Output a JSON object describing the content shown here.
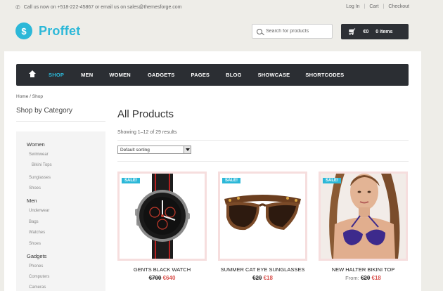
{
  "topbar": {
    "contact": "Call us now on +518-222-45867 or email us on sales@themesforge.com",
    "links": [
      "Log In",
      "Cart",
      "Checkout"
    ]
  },
  "header": {
    "logo_letter": "$",
    "logo_text": "Proffet",
    "search_placeholder": "Search for products",
    "cart_total": "€0",
    "cart_items": "0 items"
  },
  "nav": {
    "items": [
      "SHOP",
      "MEN",
      "WOMEN",
      "GADGETS",
      "PAGES",
      "BLOG",
      "SHOWCASE",
      "SHORTCODES"
    ],
    "active": "SHOP"
  },
  "breadcrumb": "Home / Shop",
  "sidebar": {
    "title": "Shop by Category",
    "categories": [
      {
        "label": "Women",
        "subs": [
          "Swimwear",
          "Bikini Tops",
          "Sunglasses",
          "Shoes"
        ]
      },
      {
        "label": "Men",
        "subs": [
          "Underwear",
          "Bags",
          "Watches",
          "Shoes"
        ]
      },
      {
        "label": "Gadgets",
        "subs": [
          "Phones",
          "Computers",
          "Cameras"
        ]
      }
    ]
  },
  "main": {
    "title": "All Products",
    "results": "Showing 1–12 of 29 results",
    "sort_selected": "Default sorting"
  },
  "colors": {
    "accent": "#2cb8d8",
    "nav_bg": "#2b2e33",
    "sale_price": "#d9534f"
  },
  "products": [
    {
      "badge": "SALE!",
      "name": "GENTS BLACK WATCH",
      "from": "",
      "old_price": "€700",
      "new_price": "€640",
      "image": "watch-image"
    },
    {
      "badge": "SALE!",
      "name": "SUMMER CAT EYE SUNGLASSES",
      "from": "",
      "old_price": "€20",
      "new_price": "€18",
      "image": "sunglasses-image"
    },
    {
      "badge": "SALE!",
      "name": "NEW HALTER BIKINI TOP",
      "from": "From:",
      "old_price": "€20",
      "new_price": "€18",
      "image": "model-bikini-image"
    }
  ]
}
